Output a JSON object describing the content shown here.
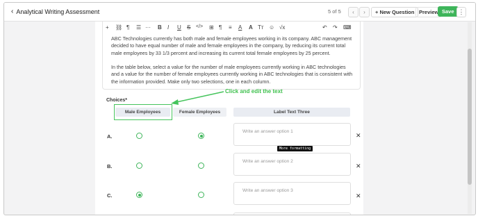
{
  "header": {
    "back_label": "Analytical Writing Assessment",
    "pager": "5 of 5",
    "prev_icon": "chevron-left-icon",
    "next_icon": "chevron-right-icon",
    "new_question": "New Question",
    "preview": "Preview",
    "save": "Save",
    "save_color": "#3eb55a"
  },
  "toolbar": {
    "icons": [
      "plus-icon",
      "link-icon",
      "paragraph-icon",
      "list-icon",
      "more-icon",
      "bold-icon",
      "italic-icon",
      "underline-icon",
      "strikethrough-icon",
      "code-icon",
      "table-icon",
      "text-direction-icon",
      "align-icon",
      "text-color-icon",
      "font-icon",
      "text-size-icon",
      "emoji-icon",
      "math-icon",
      "undo-icon",
      "redo-icon",
      "keyboard-icon"
    ],
    "glyphs": [
      "+",
      "🔗",
      "¶",
      "☰",
      "···",
      "B",
      "I",
      "U",
      "S",
      "</>",
      "⊞",
      "¶̲",
      "≡",
      "A̲",
      "A",
      "T↕",
      "☺",
      "√x",
      "↶",
      "↷",
      "⌨"
    ]
  },
  "passage": {
    "p1": "ABC Technologies currently has both male and female employees working in its company. ABC management decided to have equal number of male and female employees in the company, by reducing its current total male employees by 33 1/3 percent and increasing its current total female employees by 25 percent.",
    "p2": "In the table below, select a value for the number of male employees currently working in ABC technologies and a value for the number of female employees currently working in ABC technologies that is consistent with the information provided. Make only two selections, one in each column."
  },
  "choices": {
    "label": "Choices*",
    "columns": [
      "Male Employees",
      "Female Employees",
      "Label Text Three"
    ],
    "rows": [
      {
        "label": "A.",
        "placeholder": "Write an answer option 1",
        "selected_column": 2
      },
      {
        "label": "B.",
        "placeholder": "Write an answer option 2",
        "selected_column": 0
      },
      {
        "label": "C.",
        "placeholder": "Write an answer option 3",
        "selected_column": 1
      }
    ],
    "delete_glyph": "✕"
  },
  "tooltip": "More formatting",
  "annotation": {
    "text": "Click and edit the text",
    "color": "#3fc04e"
  }
}
